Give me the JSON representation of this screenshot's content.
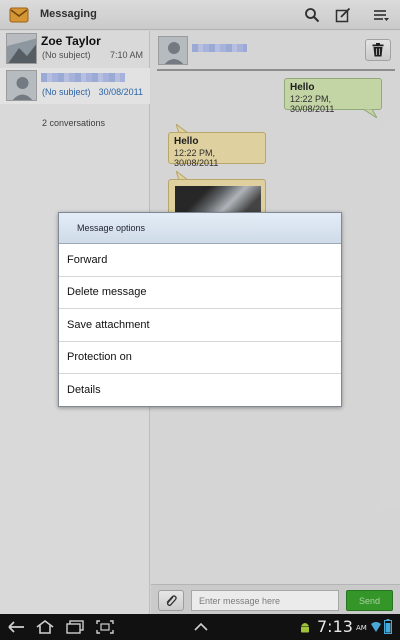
{
  "app": {
    "title": "Messaging"
  },
  "toolbar": {
    "icons": [
      "search-icon",
      "compose-icon",
      "menu-icon"
    ]
  },
  "conversations": [
    {
      "name": "Zoe Taylor",
      "subject": "(No subject)",
      "time": "7:10 AM"
    },
    {
      "name": "",
      "subject": "(No subject)",
      "time": "30/08/2011"
    }
  ],
  "conversation_count": "2 conversations",
  "thread": {
    "messages": [
      {
        "text": "Hello",
        "timestamp": "12:22 PM, 30/08/2011",
        "direction": "outgoing"
      },
      {
        "text": "Hello",
        "timestamp": "12:22 PM, 30/08/2011",
        "direction": "incoming"
      }
    ]
  },
  "compose": {
    "placeholder": "Enter message here",
    "send_label": "Send"
  },
  "dialog": {
    "title": "Message options",
    "items": [
      "Forward",
      "Delete message",
      "Save attachment",
      "Protection on",
      "Details"
    ]
  },
  "status": {
    "clock": "7:13",
    "ampm": "AM"
  },
  "colors": {
    "outgoing_bubble": "#d4e7b3",
    "incoming_bubble": "#f1e2ad",
    "send_button": "#39a22c",
    "link_text": "#2f6db5"
  }
}
